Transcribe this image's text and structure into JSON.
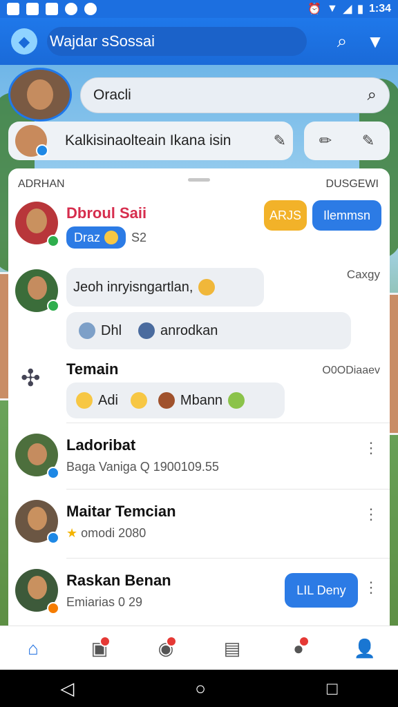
{
  "status_bar": {
    "time": "1:34",
    "left_icons": [
      "notification-icon",
      "app-icon",
      "mail-icon",
      "clock-icon",
      "play-icon"
    ],
    "right_icons": [
      "alarm-icon",
      "wifi-icon",
      "signal-icon",
      "battery-icon"
    ]
  },
  "app_bar": {
    "title": "Wajdar sSossai",
    "icons": [
      "search-icon",
      "filter-icon"
    ]
  },
  "search": {
    "value": "Oracli"
  },
  "status_prompt": {
    "text": "Kalkisinaolteain Ikana isin"
  },
  "panel": {
    "section_left": "ADRHAN",
    "section_right": "DUSGEWI",
    "rows": [
      {
        "name": "Dbroul Saii",
        "tag": "Draz",
        "tag_count": "S2",
        "buttons": [
          "ARJS",
          "Ilemmsn"
        ],
        "colors": {
          "name": "#d62d4d",
          "btn1": "#f2b229",
          "btn2": "#2c7be5"
        }
      },
      {
        "bubble": "Jeoh inryisngartlan,",
        "time": "Caxgy",
        "chips": [
          "Dhl",
          "anrodkan"
        ]
      },
      {
        "name": "Temain",
        "time": "O0ODiaaev",
        "reactions": [
          "Adi",
          "Mbann"
        ]
      },
      {
        "name": "Ladoribat",
        "sub": "Baga Vaniga  Q 1900109.55"
      },
      {
        "name": "Maitar Temcian",
        "sub": "omodi 2080"
      },
      {
        "name": "Raskan Benan",
        "sub": "Emiarias 0 29",
        "action": "LIL Deny"
      }
    ]
  },
  "bottom_nav": [
    "home-icon",
    "news-icon",
    "chat-icon",
    "wallet-icon",
    "message-icon",
    "profile-icon"
  ],
  "system_nav": [
    "back",
    "home",
    "recents"
  ]
}
